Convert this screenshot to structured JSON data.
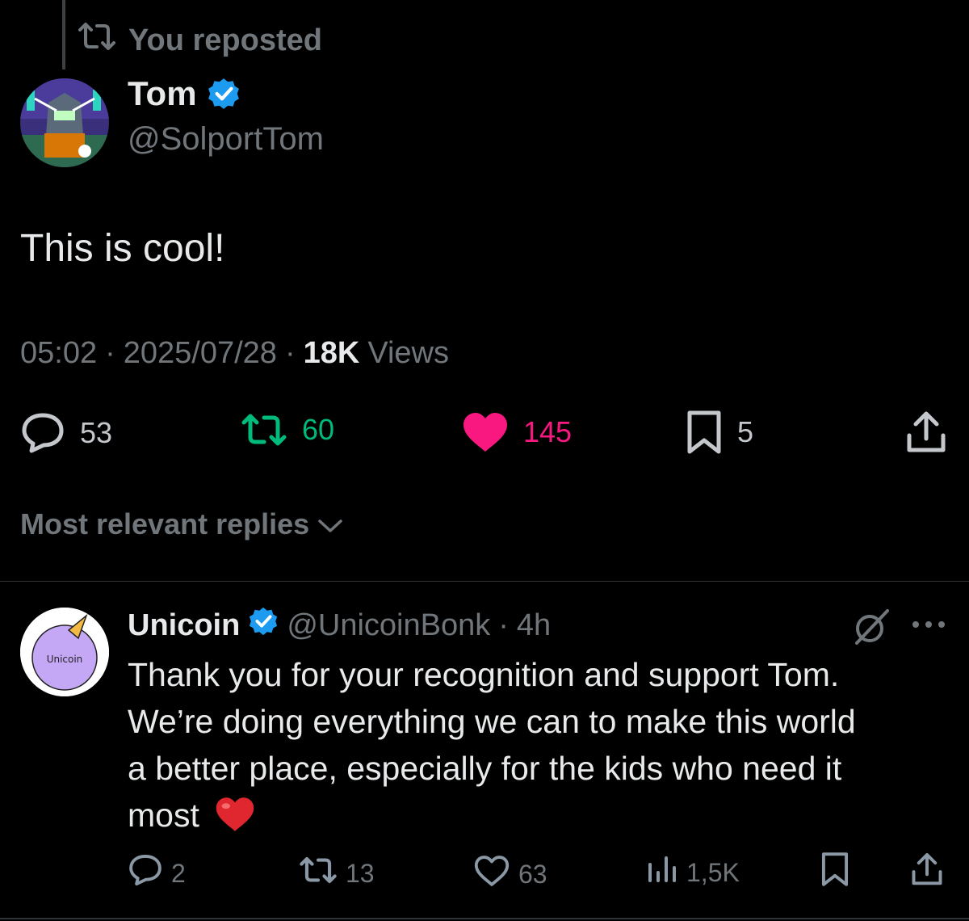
{
  "repost_banner": {
    "text": "You reposted"
  },
  "post": {
    "author_name": "Tom",
    "author_handle": "@SolportTom",
    "text": "This is cool!",
    "time": "05:02",
    "sep1": "·",
    "date": "2025/07/28",
    "sep2": "·",
    "views_count": "18K",
    "views_label": "Views",
    "replies": "53",
    "reposts": "60",
    "likes": "145",
    "bookmarks": "5"
  },
  "replies_sort": {
    "label": "Most relevant replies"
  },
  "reply": {
    "author_name": "Unicoin",
    "author_handle": "@UnicoinBonk",
    "sep": "·",
    "age": "4h",
    "avatar_text": "Unicoin",
    "text_lines": [
      "Thank you for your recognition and support Tom.",
      "We’re doing everything we can to make this world",
      "a better place, especially for the kids who need it",
      "most"
    ],
    "emoji": "❤️",
    "replies": "2",
    "reposts": "13",
    "likes": "63",
    "views": "1,5K"
  },
  "colors": {
    "background": "#000000",
    "text": "#e7e9ea",
    "muted": "#71767b",
    "verified": "#1d9bf0",
    "repost_green": "#00ba7c",
    "like_pink": "#f91880"
  },
  "icons": [
    "repost-icon",
    "verified-badge-icon",
    "reply-icon",
    "heart-icon",
    "bookmark-icon",
    "share-icon",
    "chevron-down-icon",
    "grok-slash-icon",
    "more-icon",
    "views-icon"
  ]
}
